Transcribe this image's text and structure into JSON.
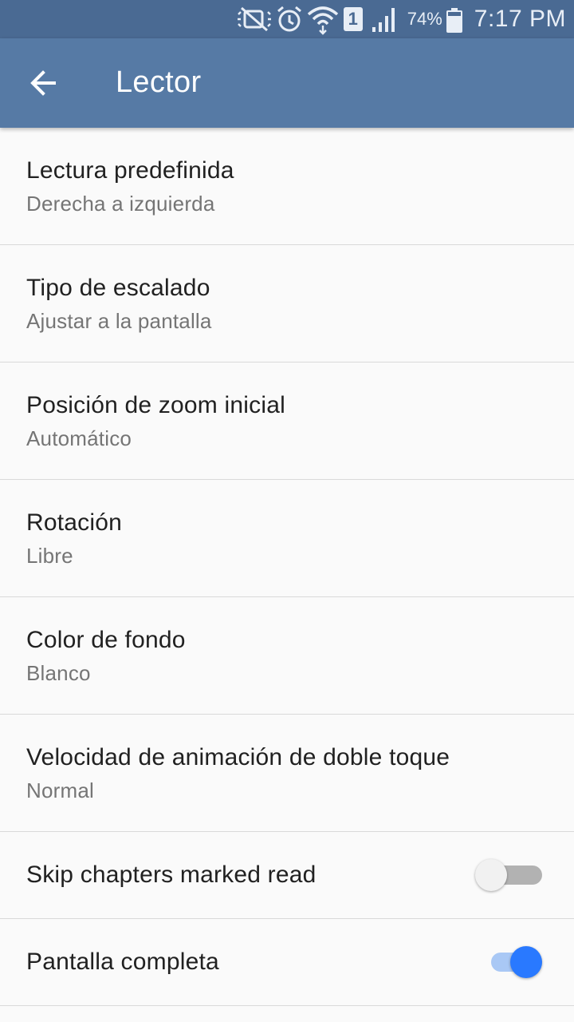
{
  "status_bar": {
    "icons": [
      "mute-vibrate-icon",
      "alarm-icon",
      "wifi-icon",
      "sim-icon",
      "signal-icon",
      "battery-icon"
    ],
    "sim_label": "1",
    "battery_percent": "74%",
    "time": "7:17 PM"
  },
  "app_bar": {
    "back_icon": "arrow-left-icon",
    "title": "Lector"
  },
  "preferences": [
    {
      "title": "Lectura predefinida",
      "summary": "Derecha a izquierda"
    },
    {
      "title": "Tipo de escalado",
      "summary": "Ajustar a la pantalla"
    },
    {
      "title": "Posición de zoom inicial",
      "summary": "Automático"
    },
    {
      "title": "Rotación",
      "summary": "Libre"
    },
    {
      "title": "Color de fondo",
      "summary": "Blanco"
    },
    {
      "title": "Velocidad de animación de doble toque",
      "summary": "Normal"
    }
  ],
  "switches": [
    {
      "title": "Skip chapters marked read",
      "checked": false
    },
    {
      "title": "Pantalla completa",
      "checked": true
    }
  ],
  "colors": {
    "status_bar": "#4a6a93",
    "app_bar": "#567aa5",
    "accent": "#2979ff",
    "background": "#fafafa"
  }
}
